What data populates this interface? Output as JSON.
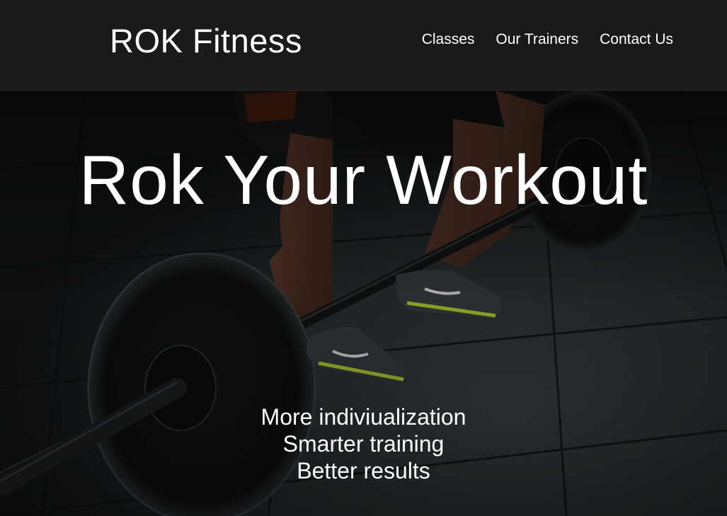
{
  "header": {
    "brand": "ROK Fitness",
    "nav": [
      {
        "label": "Classes"
      },
      {
        "label": "Our Trainers"
      },
      {
        "label": "Contact Us"
      }
    ]
  },
  "hero": {
    "title": "Rok Your Workout",
    "taglines": [
      "More indiviualization",
      "Smarter training",
      "Better results"
    ],
    "image": "barbell-deadlift-photo"
  },
  "colors": {
    "header_bg": "#1a1a1a",
    "text": "#ffffff",
    "shoe_accent": "#b8d432"
  }
}
